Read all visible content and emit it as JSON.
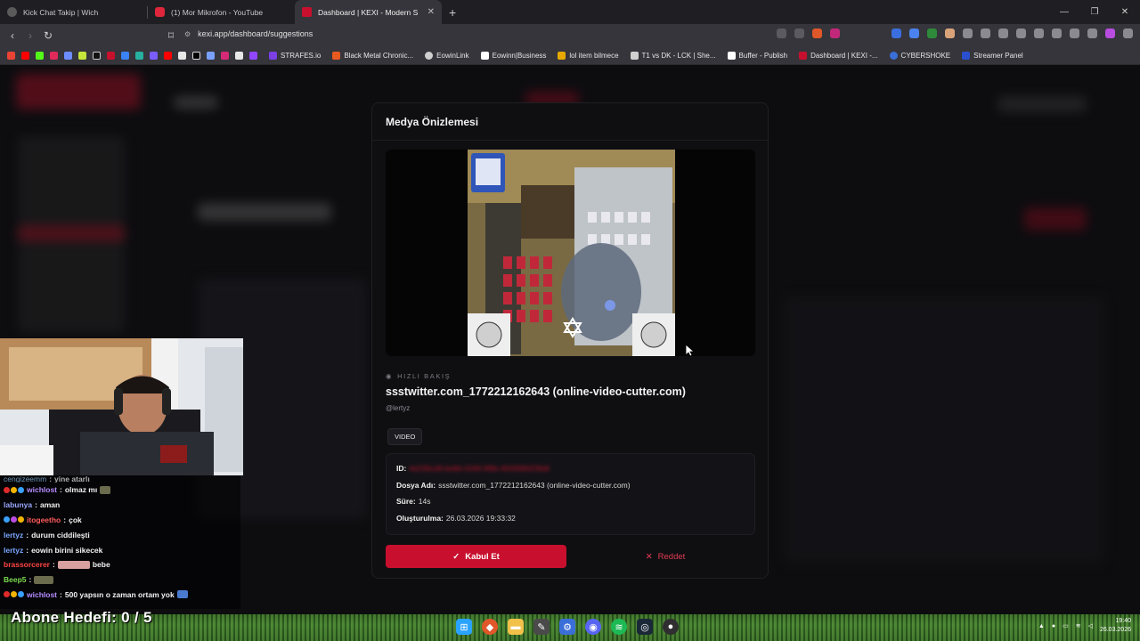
{
  "browser": {
    "tabs": [
      {
        "label": "Kick Chat Takip | Wich",
        "color": "#5a5a5a",
        "active": false
      },
      {
        "label": "(1) Mor Mikrofon - YouTube",
        "color": "#e0263c",
        "active": false
      },
      {
        "label": "Dashboard | KEXI - Modern S",
        "color": "#c8102e",
        "active": true
      }
    ],
    "url": "kexi.app/dashboard/suggestions",
    "bookmarks": [
      {
        "label": "STRAFES.io",
        "color": "#7b3fe4"
      },
      {
        "label": "Black Metal Chronic...",
        "color": "#e85a1f"
      },
      {
        "label": "EowinLink",
        "color": "#d0d0d0"
      },
      {
        "label": "Eowinn|Business",
        "color": "#ffffff"
      },
      {
        "label": "lol item bilmece",
        "color": "#e6a900"
      },
      {
        "label": "T1 vs DK - LCK | She...",
        "color": "#d0d0d0"
      },
      {
        "label": "Buffer - Publish",
        "color": "#ffffff"
      },
      {
        "label": "Dashboard | KEXI -...",
        "color": "#c8102e"
      },
      {
        "label": "CYBERSHOKE",
        "color": "#3a6fd8"
      },
      {
        "label": "Streamer Panel",
        "color": "#2a4fcf"
      }
    ]
  },
  "modal": {
    "title": "Medya Önizlemesi",
    "quick_label": "HIZLI BAKIŞ",
    "file_title": "ssstwitter.com_1772212162643 (online-video-cutter.com)",
    "uploader": "@lertyz",
    "type_badge": "VIDEO",
    "meta": {
      "id_label": "ID:",
      "id_value": "4e236cd9-be8d-4184-99fe-604368423fa8",
      "file_label": "Dosya Adı:",
      "file_value": "ssstwitter.com_1772212162643 (online-video-cutter.com)",
      "duration_label": "Süre:",
      "duration_value": "14s",
      "created_label": "Oluşturulma:",
      "created_value": "26.03.2026 19:33:32"
    },
    "accept_label": "Kabul Et",
    "reject_label": "Reddet"
  },
  "chat": [
    {
      "user": "cengizeemm",
      "msg": "yine atarlı",
      "color": "#9ad1ff"
    },
    {
      "user": "wichlost",
      "msg": "olmaz mı",
      "color": "#b58cff"
    },
    {
      "user": "labunya",
      "msg": "aman",
      "color": "#9aa8ff"
    },
    {
      "user": "itogeetho",
      "msg": "çok",
      "color": "#ff5a5a"
    },
    {
      "user": "lertyz",
      "msg": "durum ciddileşti",
      "color": "#7aa7ff"
    },
    {
      "user": "lertyz",
      "msg": "eowin birini sikecek",
      "color": "#7aa7ff"
    },
    {
      "user": "brassorcerer",
      "msg": "bebe",
      "color": "#ff4444"
    },
    {
      "user": "Beep5",
      "msg": "",
      "color": "#7cdc4f"
    },
    {
      "user": "wichlost",
      "msg": "500 yapsın o zaman ortam yok",
      "color": "#b58cff"
    }
  ],
  "goal_text": "Abone Hedefi:  0 / 5",
  "clock": {
    "time": "19:40",
    "date": "26.03.2026"
  }
}
